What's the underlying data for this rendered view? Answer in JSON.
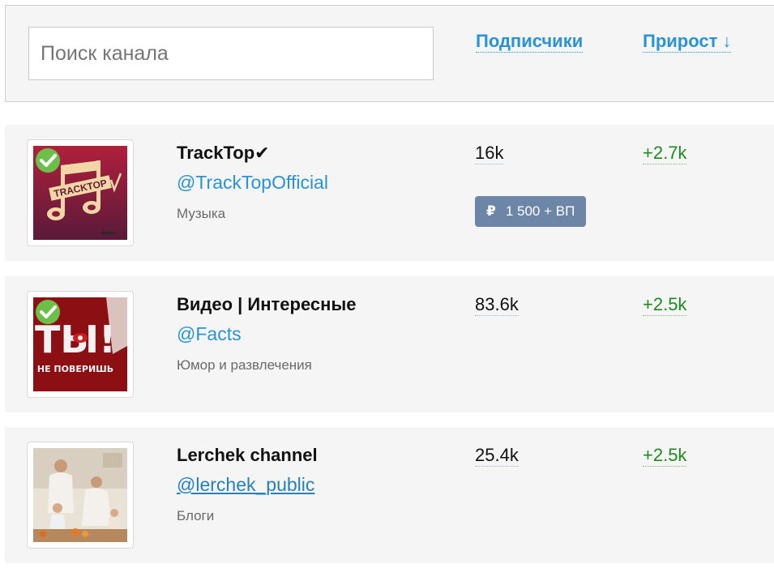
{
  "search": {
    "placeholder": "Поиск канала"
  },
  "columns": {
    "subscribers_label": "Подписчики",
    "growth_label": "Прирост",
    "growth_sort_arrow": "↓"
  },
  "channels": [
    {
      "name": "TrackTop✔",
      "handle": "@TrackTopOfficial",
      "category": "Музыка",
      "subscribers": "16k",
      "growth": "+2.7k",
      "verified": true,
      "price": {
        "currency_symbol": "₽",
        "text": "1 500 + ВП"
      },
      "avatar_icon": "tracktop-logo"
    },
    {
      "name": "Видео | Интересные",
      "handle": "@Facts",
      "category": "Юмор и развлечения",
      "subscribers": "83.6k",
      "growth": "+2.5k",
      "verified": true,
      "avatar_icon": "ty-ne-poverish-logo",
      "avatar_text_main": "ТЫ!",
      "avatar_text_sub": "НЕ ПОВЕРИШЬ"
    },
    {
      "name": "Lerchek channel",
      "handle": "@lerchek_public",
      "category": "Блоги",
      "subscribers": "25.4k",
      "growth": "+2.5k",
      "verified": false,
      "avatar_icon": "family-photo"
    }
  ],
  "colors": {
    "link": "#2a93d5",
    "growth": "#1f8a1f",
    "badge": "#6d86a8",
    "verified": "#6cc04a",
    "row_bg": "#f5f5f5"
  }
}
